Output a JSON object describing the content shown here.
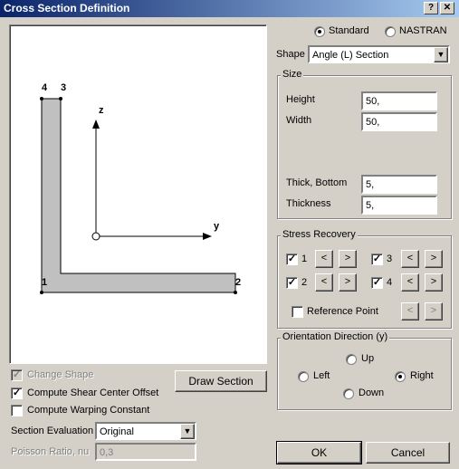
{
  "window": {
    "title": "Cross Section Definition",
    "help_label": "?",
    "close_label": "✕"
  },
  "canvas": {
    "axis_z": "z",
    "axis_y": "y",
    "corner_labels": [
      "4",
      "3",
      "1",
      "2"
    ]
  },
  "section_type": {
    "options": [
      "Standard",
      "NASTRAN"
    ],
    "selected": "Standard"
  },
  "shape": {
    "label": "Shape",
    "value": "Angle (L) Section"
  },
  "size": {
    "group_label": "Size",
    "height_label": "Height",
    "height_value": "50,",
    "width_label": "Width",
    "width_value": "50,",
    "thick_bottom_label": "Thick, Bottom",
    "thick_bottom_value": "5,",
    "thickness_label": "Thickness",
    "thickness_value": "5,"
  },
  "stress_recovery": {
    "group_label": "Stress Recovery",
    "points": [
      {
        "label": "1",
        "checked": true
      },
      {
        "label": "2",
        "checked": true
      },
      {
        "label": "3",
        "checked": true
      },
      {
        "label": "4",
        "checked": true
      }
    ],
    "prev_label": "<",
    "next_label": ">",
    "reference_point_label": "Reference Point"
  },
  "orientation": {
    "group_label": "Orientation Direction (y)",
    "up": "Up",
    "left": "Left",
    "right": "Right",
    "down": "Down",
    "selected": "Right"
  },
  "options": {
    "change_shape": "Change Shape",
    "compute_shear": "Compute Shear Center Offset",
    "compute_warping": "Compute Warping Constant",
    "draw_section": "Draw Section",
    "section_evaluation_label": "Section Evaluation",
    "section_evaluation_value": "Original",
    "poisson_label": "Poisson Ratio, nu",
    "poisson_value": "0,3"
  },
  "footer": {
    "ok": "OK",
    "cancel": "Cancel"
  }
}
